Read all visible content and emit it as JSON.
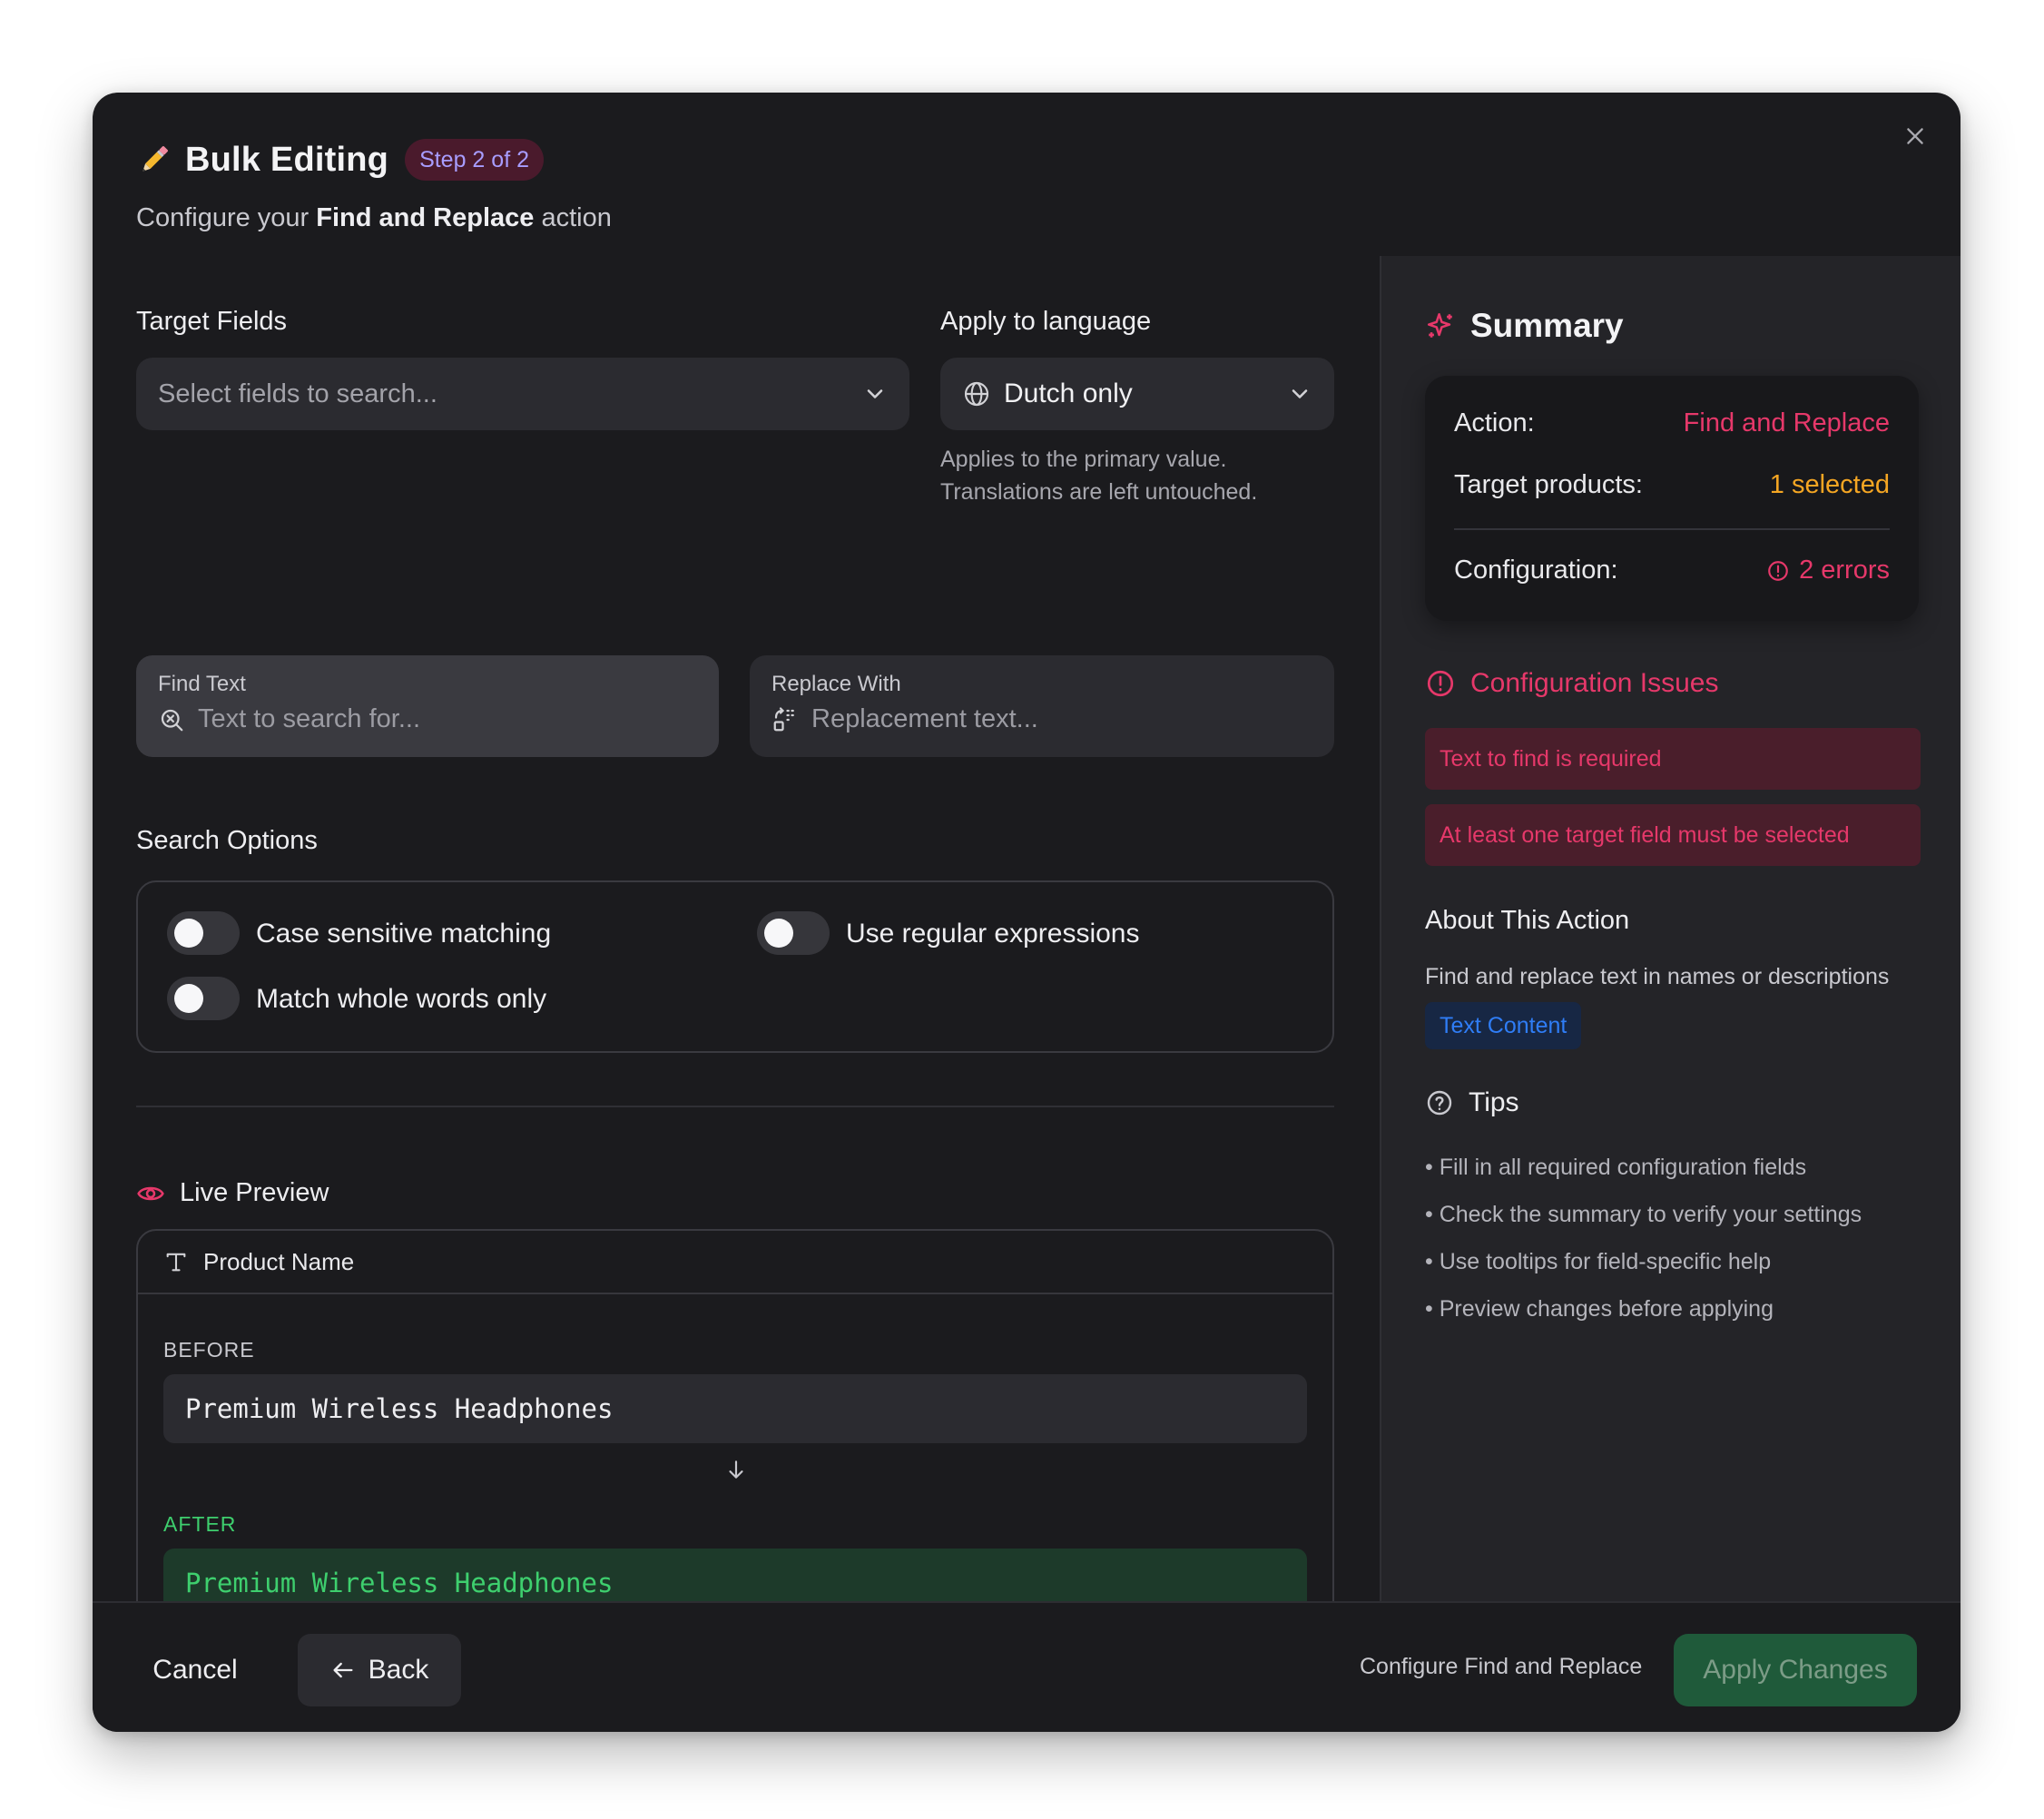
{
  "header": {
    "title": "Bulk Editing",
    "step_badge": "Step 2 of 2",
    "subtitle_prefix": "Configure your",
    "subtitle_bold": "Find and Replace",
    "subtitle_suffix": "action"
  },
  "target_fields": {
    "label": "Target Fields",
    "placeholder": "Select fields to search..."
  },
  "language": {
    "label": "Apply to language",
    "value": "Dutch only",
    "helper_line1": "Applies to the primary value.",
    "helper_line2": "Translations are left untouched."
  },
  "find": {
    "label": "Find Text",
    "placeholder": "Text to search for..."
  },
  "replace": {
    "label": "Replace With",
    "placeholder": "Replacement text..."
  },
  "search_options": {
    "title": "Search Options",
    "case_sensitive": "Case sensitive matching",
    "regex": "Use regular expressions",
    "whole_words": "Match whole words only"
  },
  "preview": {
    "title": "Live Preview",
    "field_name": "Product Name",
    "before_label": "BEFORE",
    "before_value": "Premium Wireless Headphones",
    "after_label": "AFTER",
    "after_value": "Premium Wireless Headphones"
  },
  "summary": {
    "title": "Summary",
    "action_key": "Action:",
    "action_value": "Find and Replace",
    "targets_key": "Target products:",
    "targets_value": "1 selected",
    "config_key": "Configuration:",
    "config_value": "2 errors"
  },
  "issues": {
    "title": "Configuration Issues",
    "items": [
      "Text to find is required",
      "At least one target field must be selected"
    ]
  },
  "about": {
    "title": "About This Action",
    "description": "Find and replace text in names or descriptions",
    "tag": "Text Content"
  },
  "tips": {
    "title": "Tips",
    "items": [
      "• Fill in all required configuration fields",
      "• Check the summary to verify your settings",
      "• Use tooltips for field-specific help",
      "• Preview changes before applying"
    ]
  },
  "footer": {
    "cancel": "Cancel",
    "back": "Back",
    "status": "Configure Find and Replace",
    "apply": "Apply Changes"
  },
  "colors": {
    "accent_pink": "#e6386a",
    "accent_orange": "#f5a623",
    "success_green": "#3ecf6e",
    "apply_bg": "#1f5a3a",
    "badge_bg": "#4a1a2c",
    "badge_text": "#a89dff",
    "tag_bg": "#172744",
    "tag_text": "#2f7df6"
  }
}
